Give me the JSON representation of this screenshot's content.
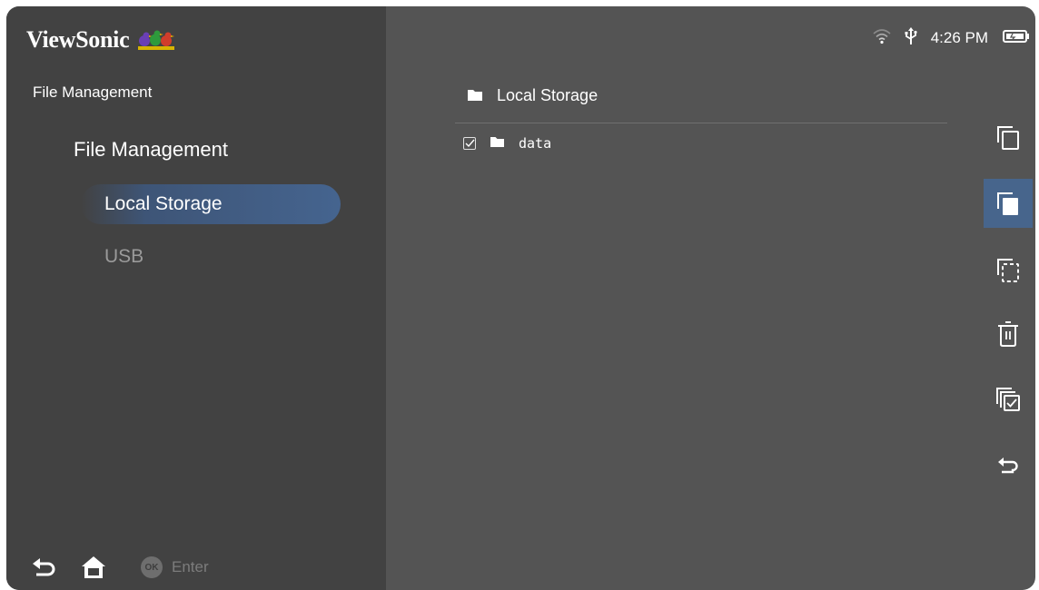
{
  "brand": {
    "name": "ViewSonic",
    "logo_icon": "three-birds-logo"
  },
  "colors": {
    "panel_bg": "#545454",
    "sidebar_bg": "#424242",
    "accent": "#45648f",
    "text": "#ffffff",
    "text_dim": "#9a9a9a"
  },
  "sidebar": {
    "section_title": "File Management",
    "heading": "File Management",
    "items": [
      {
        "label": "Local Storage",
        "state": "selected"
      },
      {
        "label": "USB",
        "state": "dimmed"
      }
    ]
  },
  "bottom_bar": {
    "back_icon": "back-arrow-icon",
    "home_icon": "home-icon",
    "ok_badge": "OK",
    "enter_label": "Enter"
  },
  "status_bar": {
    "wifi_icon": "wifi-icon",
    "usb_icon": "usb-icon",
    "time": "4:26 PM",
    "battery_icon": "battery-icon"
  },
  "main": {
    "location": "Local Storage",
    "files": [
      {
        "name": "data",
        "type": "folder",
        "checked": true
      }
    ]
  },
  "actions": [
    {
      "name": "copy",
      "icon": "copy-icon",
      "selected": false
    },
    {
      "name": "paste",
      "icon": "paste-icon",
      "selected": true
    },
    {
      "name": "cut",
      "icon": "cut-icon",
      "selected": false
    },
    {
      "name": "delete",
      "icon": "trash-icon",
      "selected": false
    },
    {
      "name": "select-all",
      "icon": "select-all-icon",
      "selected": false
    },
    {
      "name": "back",
      "icon": "return-icon",
      "selected": false
    }
  ]
}
